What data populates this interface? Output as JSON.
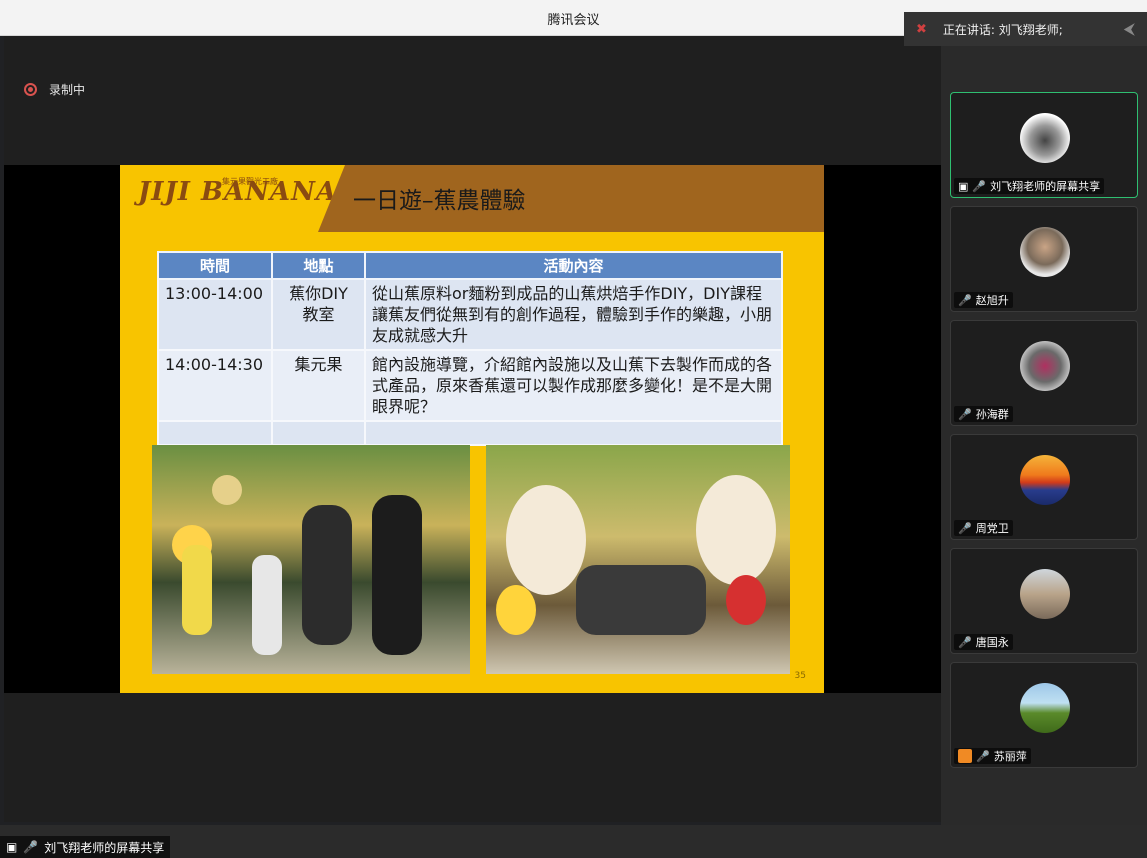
{
  "window": {
    "title": "腾讯会议"
  },
  "recording": {
    "label": "录制中"
  },
  "speaker": {
    "label": "正在讲话: 刘飞翔老师;"
  },
  "bottom_share": {
    "label": "刘飞翔老师的屏幕共享"
  },
  "slide": {
    "logo": "JIJI BANANA",
    "logo_sub": "集元果觀光工廠",
    "title": "一日遊–蕉農體驗",
    "page": "35",
    "table": {
      "headers": [
        "時間",
        "地點",
        "活動內容"
      ],
      "rows": [
        {
          "time": "13:00-14:00",
          "place": "蕉你DIY 教室",
          "activity": "從山蕉原料or麵粉到成品的山蕉烘焙手作DIY，DIY課程讓蕉友們從無到有的創作過程，體驗到手作的樂趣，小朋友成就感大升"
        },
        {
          "time": "14:00-14:30",
          "place": "集元果",
          "activity": "館內設施導覽，介紹館內設施以及山蕉下去製作而成的各式產品，原來香蕉還可以製作成那麼多變化！是不是大開眼界呢？"
        }
      ]
    }
  },
  "participants": [
    {
      "name": "刘飞翔老师的屏幕共享",
      "type": "screen"
    },
    {
      "name": "赵旭升",
      "type": "muted"
    },
    {
      "name": "孙海群",
      "type": "muted"
    },
    {
      "name": "周党卫",
      "type": "muted"
    },
    {
      "name": "唐国永",
      "type": "muted"
    },
    {
      "name": "苏丽萍",
      "type": "muted"
    }
  ],
  "colors": {
    "accent_green": "#2fbf71",
    "muted_red": "#e04848",
    "slide_yellow": "#f8c400",
    "slide_brown": "#a0651e",
    "table_header": "#5b86c3"
  }
}
